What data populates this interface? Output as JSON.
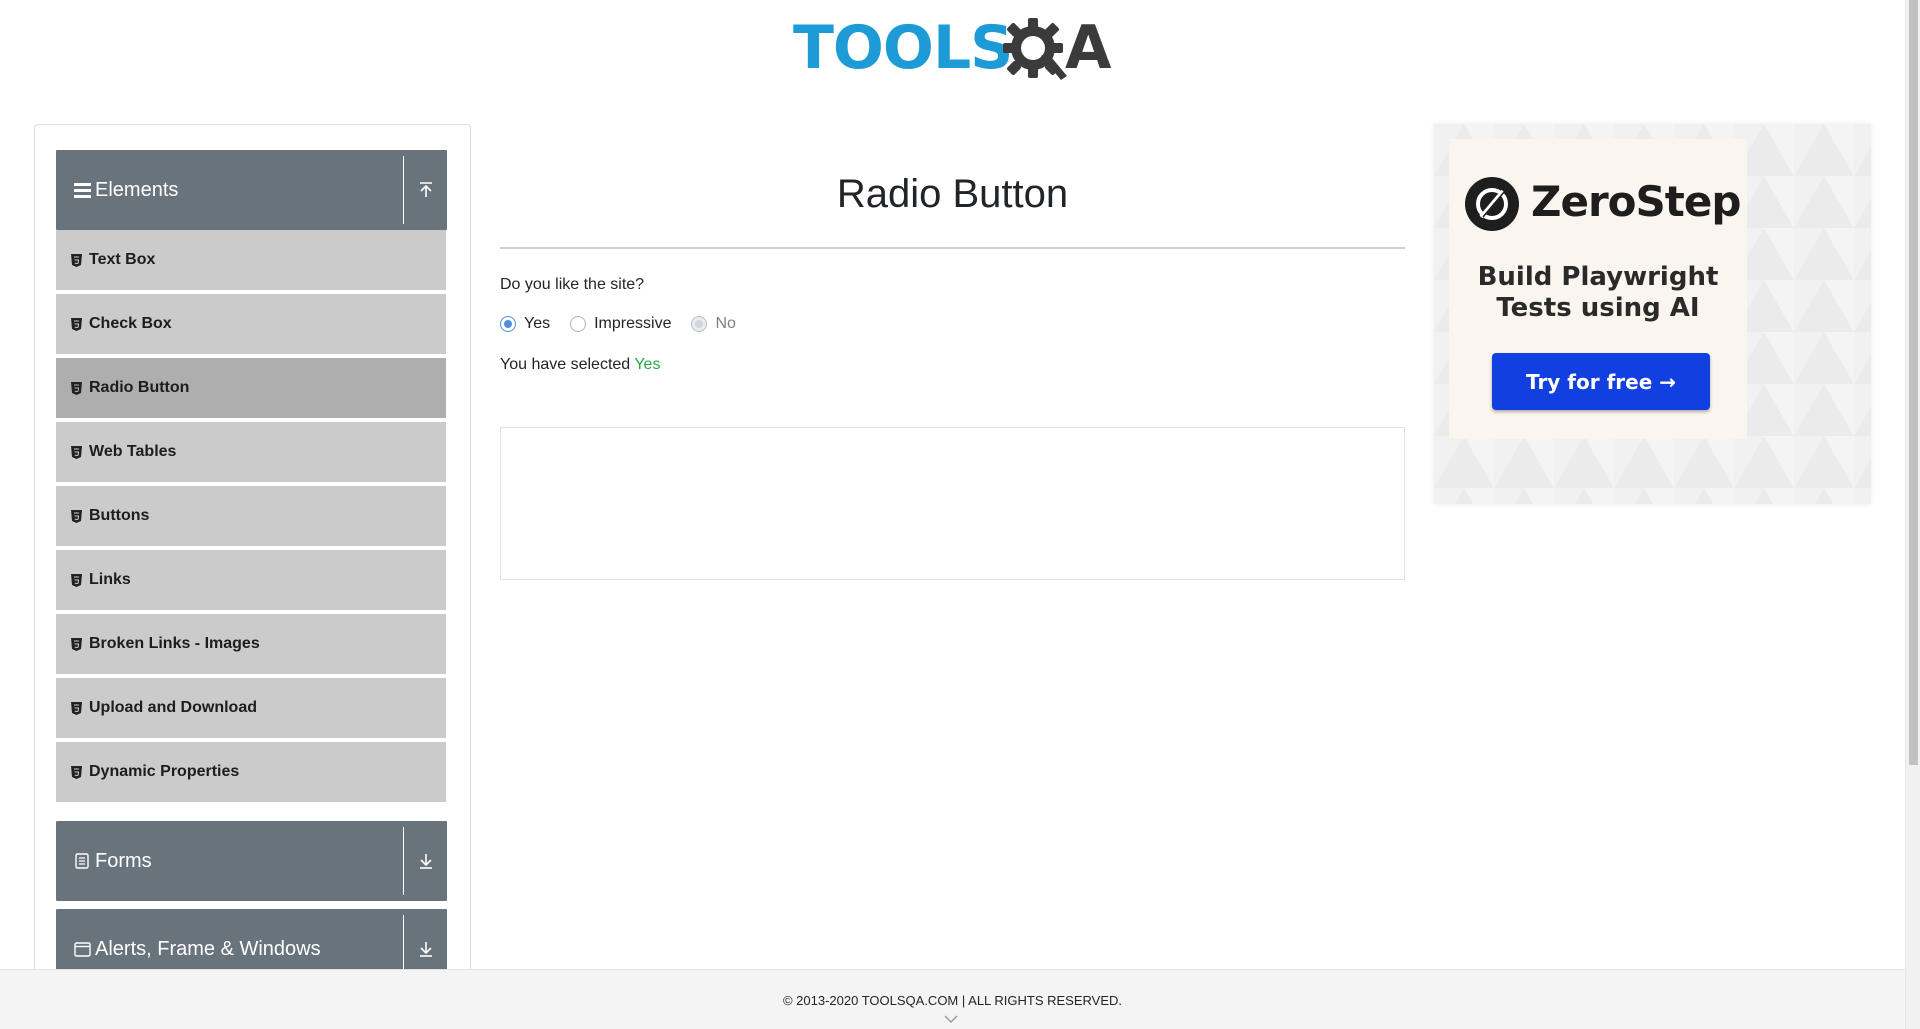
{
  "header": {
    "logo_left": "TOOLS",
    "logo_right": "A"
  },
  "sidebar": {
    "groups": [
      {
        "title": "Elements",
        "icon": "hamburger-icon",
        "toggle_icon": "collapse-up-icon"
      },
      {
        "title": "Forms",
        "icon": "document-icon",
        "toggle_icon": "expand-down-icon"
      },
      {
        "title": "Alerts, Frame & Windows",
        "icon": "window-icon",
        "toggle_icon": "expand-down-icon"
      }
    ],
    "items": [
      {
        "label": "Text Box"
      },
      {
        "label": "Check Box"
      },
      {
        "label": "Radio Button",
        "active": true
      },
      {
        "label": "Web Tables"
      },
      {
        "label": "Buttons"
      },
      {
        "label": "Links"
      },
      {
        "label": "Broken Links - Images"
      },
      {
        "label": "Upload and Download"
      },
      {
        "label": "Dynamic Properties"
      }
    ]
  },
  "main": {
    "title": "Radio Button",
    "question": "Do you like the site?",
    "options": [
      {
        "label": "Yes",
        "checked": true,
        "disabled": false
      },
      {
        "label": "Impressive",
        "checked": false,
        "disabled": false
      },
      {
        "label": "No",
        "checked": false,
        "disabled": true
      }
    ],
    "selected_prefix": "You have selected ",
    "selected_value": "Yes"
  },
  "ad": {
    "brand": "ZeroStep",
    "tagline_line1": "Build Playwright",
    "tagline_line2": "Tests using AI",
    "cta": "Try for free →"
  },
  "footer": {
    "text": "© 2013-2020 TOOLSQA.COM | ALL RIGHTS RESERVED."
  },
  "colors": {
    "group_header": "#68737c",
    "menu_item": "#cbcbcb",
    "menu_item_active": "#aeaeae",
    "selected_value": "#28a745",
    "logo_blue": "#1d9bd6",
    "cta_blue": "#1240e0"
  }
}
